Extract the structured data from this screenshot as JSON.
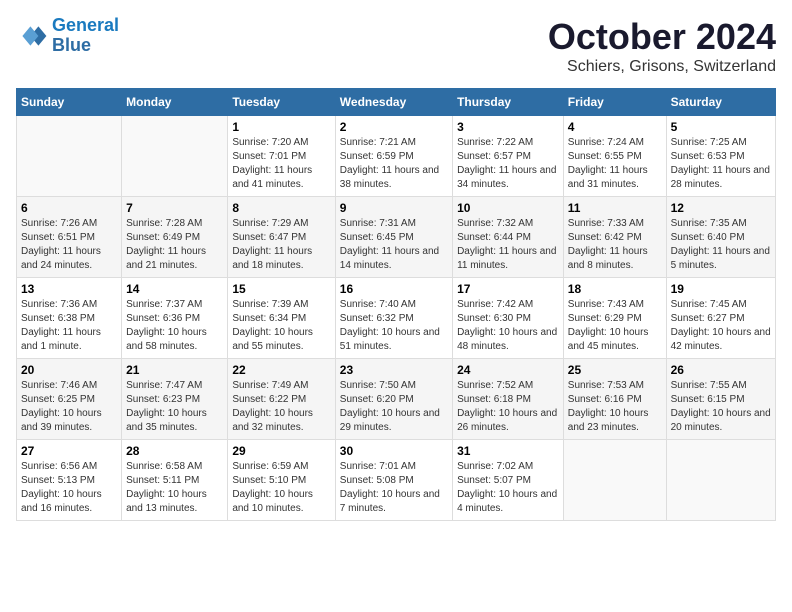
{
  "logo": {
    "line1": "General",
    "line2": "Blue"
  },
  "title": "October 2024",
  "location": "Schiers, Grisons, Switzerland",
  "weekdays": [
    "Sunday",
    "Monday",
    "Tuesday",
    "Wednesday",
    "Thursday",
    "Friday",
    "Saturday"
  ],
  "weeks": [
    [
      {
        "day": "",
        "info": ""
      },
      {
        "day": "",
        "info": ""
      },
      {
        "day": "1",
        "info": "Sunrise: 7:20 AM\nSunset: 7:01 PM\nDaylight: 11 hours and 41 minutes."
      },
      {
        "day": "2",
        "info": "Sunrise: 7:21 AM\nSunset: 6:59 PM\nDaylight: 11 hours and 38 minutes."
      },
      {
        "day": "3",
        "info": "Sunrise: 7:22 AM\nSunset: 6:57 PM\nDaylight: 11 hours and 34 minutes."
      },
      {
        "day": "4",
        "info": "Sunrise: 7:24 AM\nSunset: 6:55 PM\nDaylight: 11 hours and 31 minutes."
      },
      {
        "day": "5",
        "info": "Sunrise: 7:25 AM\nSunset: 6:53 PM\nDaylight: 11 hours and 28 minutes."
      }
    ],
    [
      {
        "day": "6",
        "info": "Sunrise: 7:26 AM\nSunset: 6:51 PM\nDaylight: 11 hours and 24 minutes."
      },
      {
        "day": "7",
        "info": "Sunrise: 7:28 AM\nSunset: 6:49 PM\nDaylight: 11 hours and 21 minutes."
      },
      {
        "day": "8",
        "info": "Sunrise: 7:29 AM\nSunset: 6:47 PM\nDaylight: 11 hours and 18 minutes."
      },
      {
        "day": "9",
        "info": "Sunrise: 7:31 AM\nSunset: 6:45 PM\nDaylight: 11 hours and 14 minutes."
      },
      {
        "day": "10",
        "info": "Sunrise: 7:32 AM\nSunset: 6:44 PM\nDaylight: 11 hours and 11 minutes."
      },
      {
        "day": "11",
        "info": "Sunrise: 7:33 AM\nSunset: 6:42 PM\nDaylight: 11 hours and 8 minutes."
      },
      {
        "day": "12",
        "info": "Sunrise: 7:35 AM\nSunset: 6:40 PM\nDaylight: 11 hours and 5 minutes."
      }
    ],
    [
      {
        "day": "13",
        "info": "Sunrise: 7:36 AM\nSunset: 6:38 PM\nDaylight: 11 hours and 1 minute."
      },
      {
        "day": "14",
        "info": "Sunrise: 7:37 AM\nSunset: 6:36 PM\nDaylight: 10 hours and 58 minutes."
      },
      {
        "day": "15",
        "info": "Sunrise: 7:39 AM\nSunset: 6:34 PM\nDaylight: 10 hours and 55 minutes."
      },
      {
        "day": "16",
        "info": "Sunrise: 7:40 AM\nSunset: 6:32 PM\nDaylight: 10 hours and 51 minutes."
      },
      {
        "day": "17",
        "info": "Sunrise: 7:42 AM\nSunset: 6:30 PM\nDaylight: 10 hours and 48 minutes."
      },
      {
        "day": "18",
        "info": "Sunrise: 7:43 AM\nSunset: 6:29 PM\nDaylight: 10 hours and 45 minutes."
      },
      {
        "day": "19",
        "info": "Sunrise: 7:45 AM\nSunset: 6:27 PM\nDaylight: 10 hours and 42 minutes."
      }
    ],
    [
      {
        "day": "20",
        "info": "Sunrise: 7:46 AM\nSunset: 6:25 PM\nDaylight: 10 hours and 39 minutes."
      },
      {
        "day": "21",
        "info": "Sunrise: 7:47 AM\nSunset: 6:23 PM\nDaylight: 10 hours and 35 minutes."
      },
      {
        "day": "22",
        "info": "Sunrise: 7:49 AM\nSunset: 6:22 PM\nDaylight: 10 hours and 32 minutes."
      },
      {
        "day": "23",
        "info": "Sunrise: 7:50 AM\nSunset: 6:20 PM\nDaylight: 10 hours and 29 minutes."
      },
      {
        "day": "24",
        "info": "Sunrise: 7:52 AM\nSunset: 6:18 PM\nDaylight: 10 hours and 26 minutes."
      },
      {
        "day": "25",
        "info": "Sunrise: 7:53 AM\nSunset: 6:16 PM\nDaylight: 10 hours and 23 minutes."
      },
      {
        "day": "26",
        "info": "Sunrise: 7:55 AM\nSunset: 6:15 PM\nDaylight: 10 hours and 20 minutes."
      }
    ],
    [
      {
        "day": "27",
        "info": "Sunrise: 6:56 AM\nSunset: 5:13 PM\nDaylight: 10 hours and 16 minutes."
      },
      {
        "day": "28",
        "info": "Sunrise: 6:58 AM\nSunset: 5:11 PM\nDaylight: 10 hours and 13 minutes."
      },
      {
        "day": "29",
        "info": "Sunrise: 6:59 AM\nSunset: 5:10 PM\nDaylight: 10 hours and 10 minutes."
      },
      {
        "day": "30",
        "info": "Sunrise: 7:01 AM\nSunset: 5:08 PM\nDaylight: 10 hours and 7 minutes."
      },
      {
        "day": "31",
        "info": "Sunrise: 7:02 AM\nSunset: 5:07 PM\nDaylight: 10 hours and 4 minutes."
      },
      {
        "day": "",
        "info": ""
      },
      {
        "day": "",
        "info": ""
      }
    ]
  ]
}
